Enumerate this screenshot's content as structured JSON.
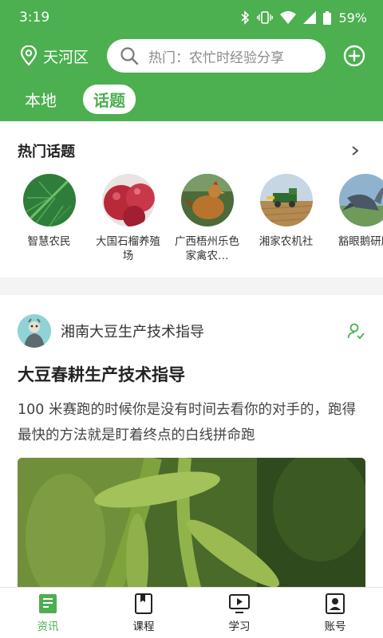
{
  "status_bar": {
    "time": "3:19",
    "battery": "59%"
  },
  "header": {
    "location": "天河区",
    "search_placeholder": "热门：农忙时经验分享",
    "tabs": [
      {
        "label": "本地",
        "active": false
      },
      {
        "label": "话题",
        "active": true
      }
    ]
  },
  "topics": {
    "title": "热门话题",
    "items": [
      {
        "name": "智慧农民"
      },
      {
        "name": "大国石榴养殖场"
      },
      {
        "name": "广西梧州乐色家禽农…"
      },
      {
        "name": "湘家农机社"
      },
      {
        "name": "豁眼鹅研所"
      }
    ]
  },
  "post": {
    "author": "湘南大豆生产技术指导",
    "title": "大豆春耕生产技术指导",
    "body": "100 米赛跑的时候你是没有时间去看你的对手的，跑得最快的方法就是盯着终点的白线拼命跑"
  },
  "bottom_nav": [
    {
      "label": "资讯",
      "active": true
    },
    {
      "label": "课程",
      "active": false
    },
    {
      "label": "学习",
      "active": false
    },
    {
      "label": "账号",
      "active": false
    }
  ],
  "colors": {
    "brand": "#4caf50"
  }
}
